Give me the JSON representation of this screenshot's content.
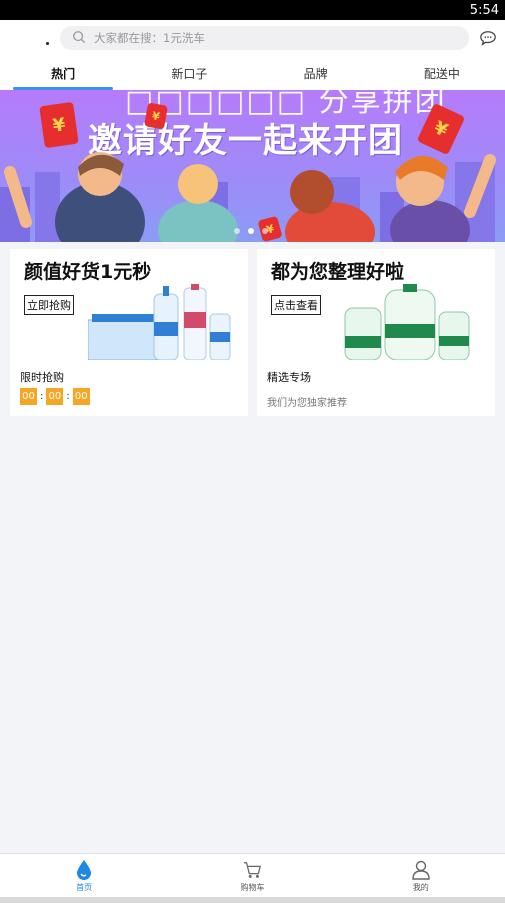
{
  "status_bar": {
    "time": "5:54"
  },
  "search": {
    "placeholder": "大家都在搜：1元洗车"
  },
  "tabs": [
    {
      "label": "热门",
      "active": true
    },
    {
      "label": "新口子",
      "active": false
    },
    {
      "label": "品牌",
      "active": false
    },
    {
      "label": "配送中",
      "active": false
    }
  ],
  "banner": {
    "top_text": "□□□□□□ 分享拼团",
    "headline": "邀请好友一起来开团",
    "redpack_symbol": "¥",
    "dots_count": 3,
    "active_dot": 2
  },
  "cards": [
    {
      "title": "颜值好货1元秒",
      "button": "立即抢购",
      "subtitle": "限时抢购",
      "timer": [
        "00",
        "00",
        "00"
      ],
      "timer_sep": ":"
    },
    {
      "title": "都为您整理好啦",
      "button": "点击查看",
      "subtitle": "精选专场",
      "desc": "我们为您独家推荐"
    }
  ],
  "tabbar": [
    {
      "label": "首页",
      "icon": "water-drop-icon",
      "active": true
    },
    {
      "label": "购物车",
      "icon": "cart-icon",
      "active": false
    },
    {
      "label": "我的",
      "icon": "user-icon",
      "active": false
    }
  ],
  "colors": {
    "accent": "#3f8ff0",
    "timer": "#f5a623",
    "active_tab": "#1e88e5"
  }
}
